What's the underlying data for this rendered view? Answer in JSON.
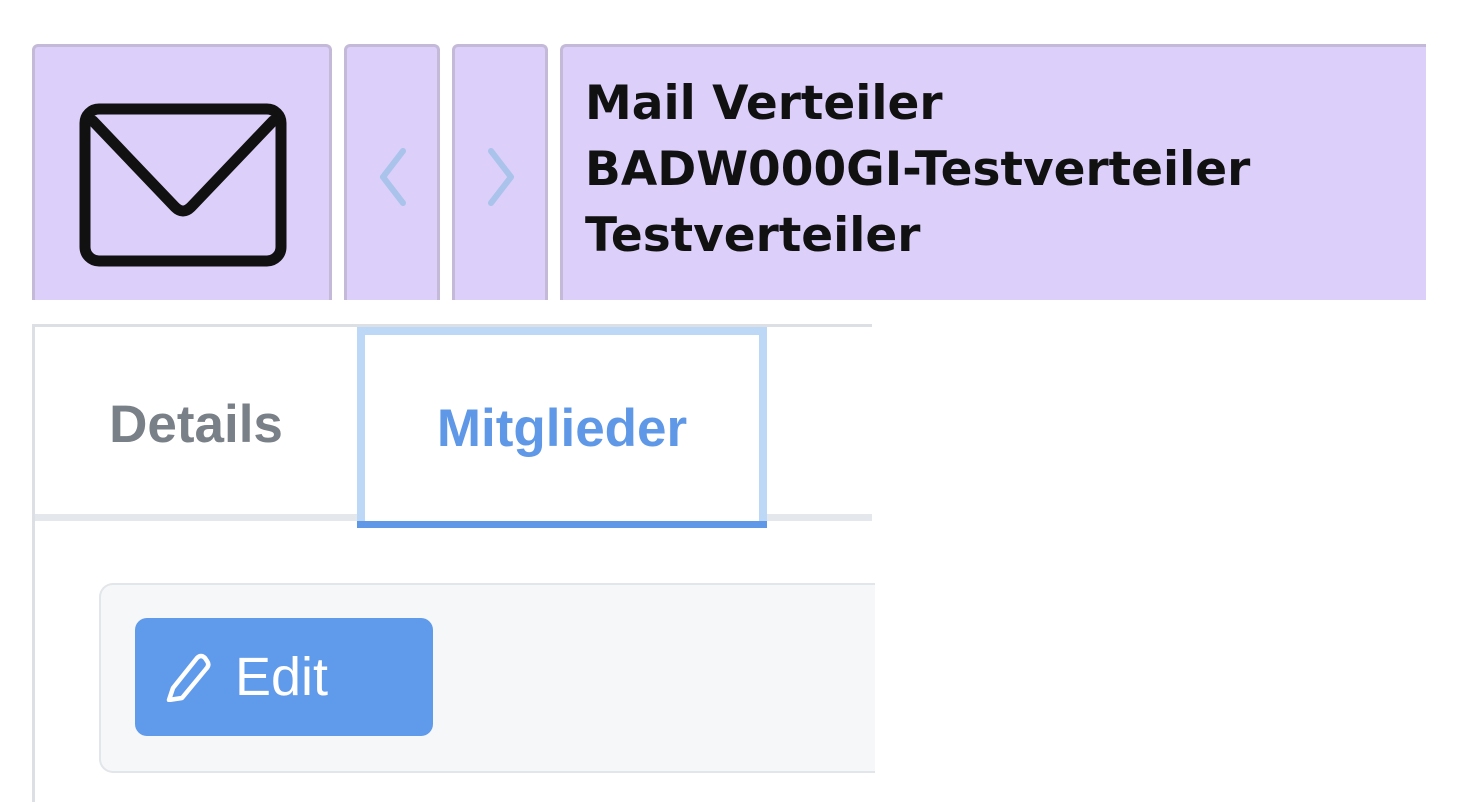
{
  "header": {
    "mail_icon": "envelope-icon",
    "prev_icon": "chevron-left-icon",
    "next_icon": "chevron-right-icon",
    "title_lines": [
      "Mail Verteiler",
      "BADW000GI-Testverteiler",
      "Testverteiler"
    ],
    "header_bg": "#dccffa",
    "chevron_color": "#a9c3ea"
  },
  "tabs": [
    {
      "label": "Details",
      "active": false
    },
    {
      "label": "Mitglieder",
      "active": true
    }
  ],
  "toolbar": {
    "edit_label": "Edit",
    "edit_icon": "pencil-icon",
    "accent": "#5f9aeb"
  }
}
